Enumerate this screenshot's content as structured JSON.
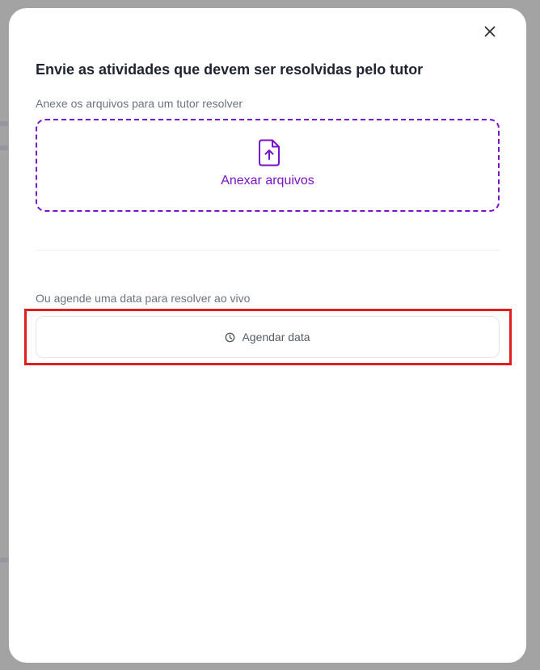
{
  "modal": {
    "title": "Envie as atividades que devem ser resolvidas pelo tutor",
    "close_icon": "close-icon"
  },
  "attach": {
    "label": "Anexe os arquivos para um tutor resolver",
    "button_label": "Anexar arquivos",
    "icon": "file-upload-icon",
    "accent_color": "#7b12c9"
  },
  "schedule": {
    "label": "Ou agende uma data para resolver ao vivo",
    "button_label": "Agendar data",
    "icon": "clock-icon"
  },
  "highlight": {
    "color": "#e11d1d"
  }
}
